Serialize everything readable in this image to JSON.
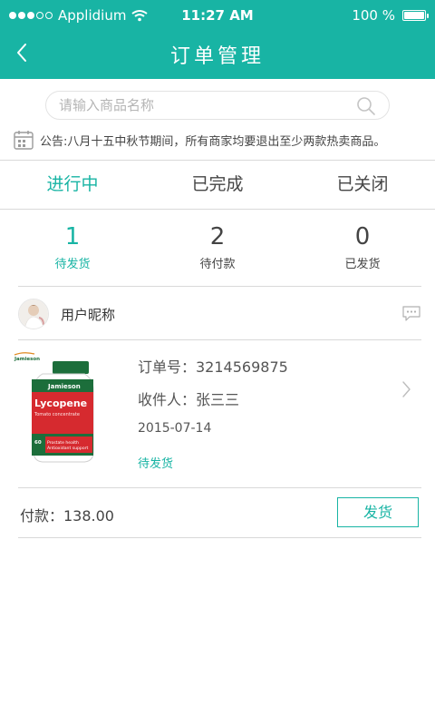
{
  "status_bar": {
    "carrier": "Applidium",
    "time": "11:27 AM",
    "battery": "100 %",
    "battery_level": 1.0,
    "signal_bars_filled": 3,
    "signal_bars_total": 5
  },
  "header": {
    "title": "订单管理",
    "back_icon": "chevron-left-icon",
    "background_color": "#18b4a4"
  },
  "search": {
    "placeholder": "请输入商品名称",
    "value": "",
    "icon": "search-icon"
  },
  "notice": {
    "icon": "calendar-icon",
    "text": "公告:八月十五中秋节期间，所有商家均要退出至少两款热卖商品。"
  },
  "tabs": [
    {
      "label": "进行中",
      "active": true
    },
    {
      "label": "已完成",
      "active": false
    },
    {
      "label": "已关闭",
      "active": false
    }
  ],
  "counts": [
    {
      "value": "1",
      "label": "待发货",
      "active": true
    },
    {
      "value": "2",
      "label": "待付款",
      "active": false
    },
    {
      "value": "0",
      "label": "已发货",
      "active": false
    }
  ],
  "order": {
    "user_nickname": "用户昵称",
    "message_icon": "chat-bubble-icon",
    "product_image": {
      "brand": "Jamieson",
      "product": "Lycopene",
      "subtitle": "Tomato concentrate",
      "count": "60",
      "claim_line1": "Prostate health",
      "claim_line2": "Antioxidant support"
    },
    "order_number": "订单号：3214569875",
    "recipient": "收件人：张三三",
    "date": "2015-07-14",
    "status": "待发货",
    "payment": "付款：138.00",
    "action_label": "发货"
  },
  "colors": {
    "accent": "#18b4a4",
    "divider": "#d9d9d9",
    "text": "#444444"
  }
}
